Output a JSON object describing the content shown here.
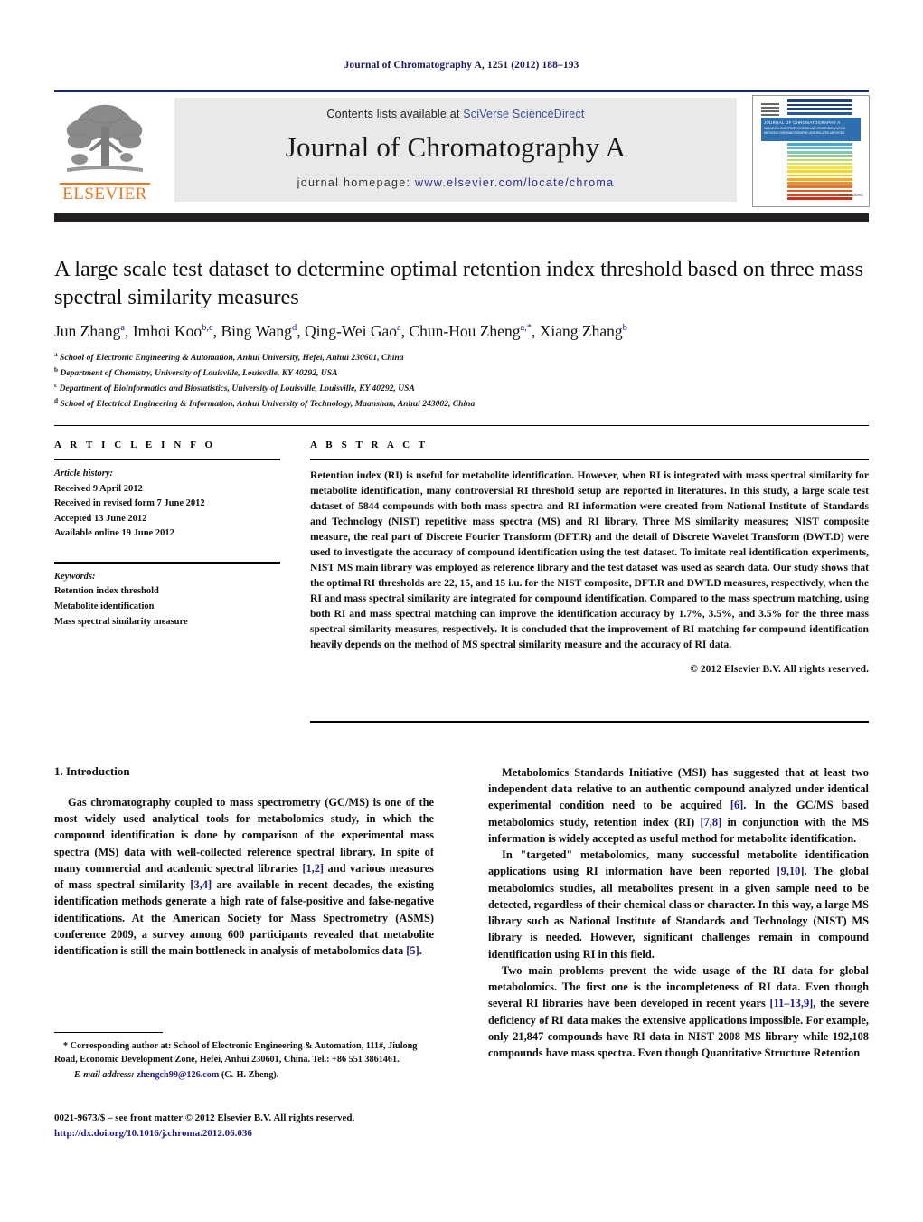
{
  "running_head": "Journal of Chromatography A, 1251 (2012) 188–193",
  "masthead": {
    "contents_prefix": "Contents lists available at ",
    "contents_link": "SciVerse ScienceDirect",
    "journal_title": "Journal of Chromatography A",
    "homepage_prefix": "journal homepage: ",
    "homepage_link": "www.elsevier.com/locate/chroma",
    "publisher_name": "ELSEVIER",
    "publisher_logo_icon": "elsevier-tree-icon",
    "cover_thumbnail_icon": "journal-cover-icon",
    "cover_title": "JOURNAL OF CHROMATOGRAPHY A",
    "cover_subtitle": "INCLUDING ELECTROPHORESIS AND OTHER SEPARATION METHODS CHROMATOGRAPHIC AND RELATED METHODS",
    "cover_brand": "ScienceDirect",
    "accent_orange": "#E87722",
    "accent_blue": "#1a2a6c",
    "link_blue": "#2b2b8f"
  },
  "title": "A large scale test dataset to determine optimal retention index threshold based on three mass spectral similarity measures",
  "authors_html": "Jun Zhang<sup>a</sup>, Imhoi Koo<sup>b,c</sup>, Bing Wang<sup>d</sup>, Qing-Wei Gao<sup>a</sup>, Chun-Hou Zheng<sup>a,*</sup>, Xiang Zhang<sup>b</sup>",
  "affiliations": [
    {
      "marker": "a",
      "text": "School of Electronic Engineering & Automation, Anhui University, Hefei, Anhui 230601, China"
    },
    {
      "marker": "b",
      "text": "Department of Chemistry, University of Louisville, Louisville, KY 40292, USA"
    },
    {
      "marker": "c",
      "text": "Department of Bioinformatics and Biostatistics, University of Louisville, Louisville, KY 40292, USA"
    },
    {
      "marker": "d",
      "text": "School of Electrical Engineering & Information, Anhui University of Technology, Maanshan, Anhui 243002, China"
    }
  ],
  "article_info": {
    "heading": "A R T I C L E   I N F O",
    "history_label": "Article history:",
    "history": [
      "Received 9 April 2012",
      "Received in revised form 7 June 2012",
      "Accepted 13 June 2012",
      "Available online 19 June 2012"
    ],
    "keywords_label": "Keywords:",
    "keywords": [
      "Retention index threshold",
      "Metabolite identification",
      "Mass spectral similarity measure"
    ]
  },
  "abstract": {
    "heading": "A B S T R A C T",
    "text": "Retention index (RI) is useful for metabolite identification. However, when RI is integrated with mass spectral similarity for metabolite identification, many controversial RI threshold setup are reported in literatures. In this study, a large scale test dataset of 5844 compounds with both mass spectra and RI information were created from National Institute of Standards and Technology (NIST) repetitive mass spectra (MS) and RI library. Three MS similarity measures; NIST composite measure, the real part of Discrete Fourier Transform (DFT.R) and the detail of Discrete Wavelet Transform (DWT.D) were used to investigate the accuracy of compound identification using the test dataset. To imitate real identification experiments, NIST MS main library was employed as reference library and the test dataset was used as search data. Our study shows that the optimal RI thresholds are 22, 15, and 15 i.u. for the NIST composite, DFT.R and DWT.D measures, respectively, when the RI and mass spectral similarity are integrated for compound identification. Compared to the mass spectrum matching, using both RI and mass spectral matching can improve the identification accuracy by 1.7%, 3.5%, and 3.5% for the three mass spectral similarity measures, respectively. It is concluded that the improvement of RI matching for compound identification heavily depends on the method of MS spectral similarity measure and the accuracy of RI data.",
    "copyright": "© 2012 Elsevier B.V. All rights reserved."
  },
  "body": {
    "section_heading": "1.  Introduction",
    "left_paragraphs": [
      "Gas chromatography coupled to mass spectrometry (GC/MS) is one of the most widely used analytical tools for metabolomics study, in which the compound identification is done by comparison of the experimental mass spectra (MS) data with well-collected reference spectral library. In spite of many commercial and academic spectral libraries [1,2] and various measures of mass spectral similarity [3,4] are available in recent decades, the existing identification methods generate a high rate of false-positive and false-negative identifications. At the American Society for Mass Spectrometry (ASMS) conference 2009, a survey among 600 participants revealed that metabolite identification is still the main bottleneck in analysis of metabolomics data [5]."
    ],
    "right_paragraphs": [
      "Metabolomics Standards Initiative (MSI) has suggested that at least two independent data relative to an authentic compound analyzed under identical experimental condition need to be acquired [6]. In the GC/MS based metabolomics study, retention index (RI) [7,8] in conjunction with the MS information is widely accepted as useful method for metabolite identification.",
      "In \"targeted\" metabolomics, many successful metabolite identification applications using RI information have been reported [9,10]. The global metabolomics studies, all metabolites present in a given sample need to be detected, regardless of their chemical class or character. In this way, a large MS library such as National Institute of Standards and Technology (NIST) MS library is needed. However, significant challenges remain in compound identification using RI in this field.",
      "Two main problems prevent the wide usage of the RI data for global metabolomics. The first one is the incompleteness of RI data. Even though several RI libraries have been developed in recent years [11–13,9], the severe deficiency of RI data makes the extensive applications impossible. For example, only 21,847 compounds have RI data in NIST 2008 MS library while 192,108 compounds have mass spectra. Even though Quantitative Structure Retention"
    ]
  },
  "footnotes": {
    "corresponding": "* Corresponding author at: School of Electronic Engineering & Automation, 111#, Jiulong Road, Economic Development Zone, Hefei, Anhui 230601, China. Tel.: +86 551 3861461.",
    "email_label": "E-mail address:",
    "email": "zhengch99@126.com",
    "email_suffix": " (C.-H. Zheng)."
  },
  "imprint": {
    "line1": "0021-9673/$ – see front matter © 2012 Elsevier B.V. All rights reserved.",
    "line2": "http://dx.doi.org/10.1016/j.chroma.2012.06.036"
  }
}
